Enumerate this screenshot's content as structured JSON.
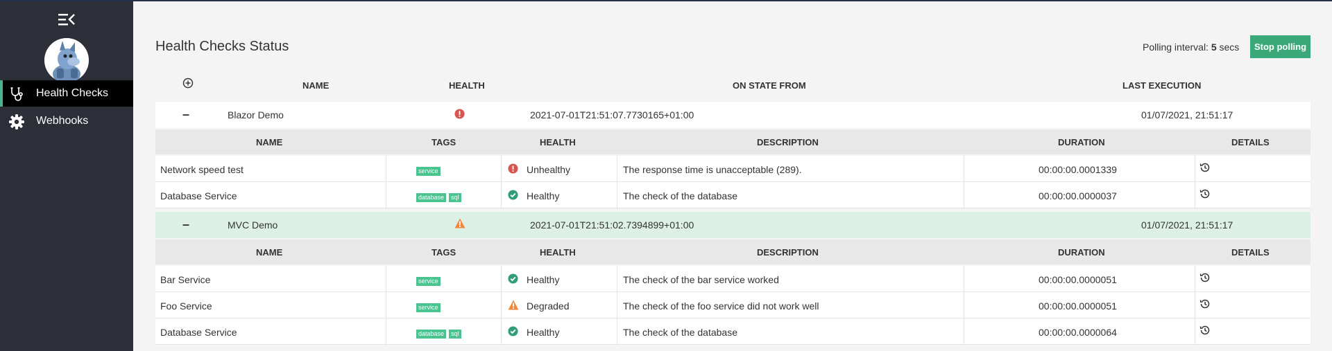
{
  "sidebar": {
    "items": [
      {
        "label": "Health Checks",
        "icon": "stethoscope-icon",
        "active": true
      },
      {
        "label": "Webhooks",
        "icon": "gear-icon",
        "active": false
      }
    ]
  },
  "header": {
    "title": "Health Checks Status",
    "polling_prefix": "Polling interval:",
    "polling_value": "5",
    "polling_unit": "secs",
    "stop_label": "Stop polling"
  },
  "columns": {
    "name": "NAME",
    "health": "HEALTH",
    "on_state_from": "ON STATE FROM",
    "last_execution": "LAST EXECUTION"
  },
  "sub_columns": {
    "name": "NAME",
    "tags": "TAGS",
    "health": "HEALTH",
    "description": "DESCRIPTION",
    "duration": "DURATION",
    "details": "DETAILS"
  },
  "groups": [
    {
      "name": "Blazor Demo",
      "health": "unhealthy",
      "on_state_from": "2021-07-01T21:51:07.7730165+01:00",
      "last_execution": "01/07/2021, 21:51:17",
      "entries": [
        {
          "name": "Network speed test",
          "tags": [
            "service"
          ],
          "status": "Unhealthy",
          "description": "The response time is unacceptable (289).",
          "duration": "00:00:00.0001339"
        },
        {
          "name": "Database Service",
          "tags": [
            "database",
            "sql"
          ],
          "status": "Healthy",
          "description": "The check of the database",
          "duration": "00:00:00.0000037"
        }
      ]
    },
    {
      "name": "MVC Demo",
      "health": "degraded",
      "on_state_from": "2021-07-01T21:51:02.7394899+01:00",
      "last_execution": "01/07/2021, 21:51:17",
      "entries": [
        {
          "name": "Bar Service",
          "tags": [
            "service"
          ],
          "status": "Healthy",
          "description": "The check of the bar service worked",
          "duration": "00:00:00.0000051"
        },
        {
          "name": "Foo Service",
          "tags": [
            "service"
          ],
          "status": "Degraded",
          "description": "The check of the foo service did not work well",
          "duration": "00:00:00.0000051"
        },
        {
          "name": "Database Service",
          "tags": [
            "database",
            "sql"
          ],
          "status": "Healthy",
          "description": "The check of the database",
          "duration": "00:00:00.0000064"
        }
      ]
    }
  ],
  "colors": {
    "sidebar": "#2c2f38",
    "accent": "#3ba87a",
    "unhealthy": "#d9534f",
    "healthy": "#2f9e74",
    "degraded": "#f0883e",
    "tag": "#49c48f"
  }
}
